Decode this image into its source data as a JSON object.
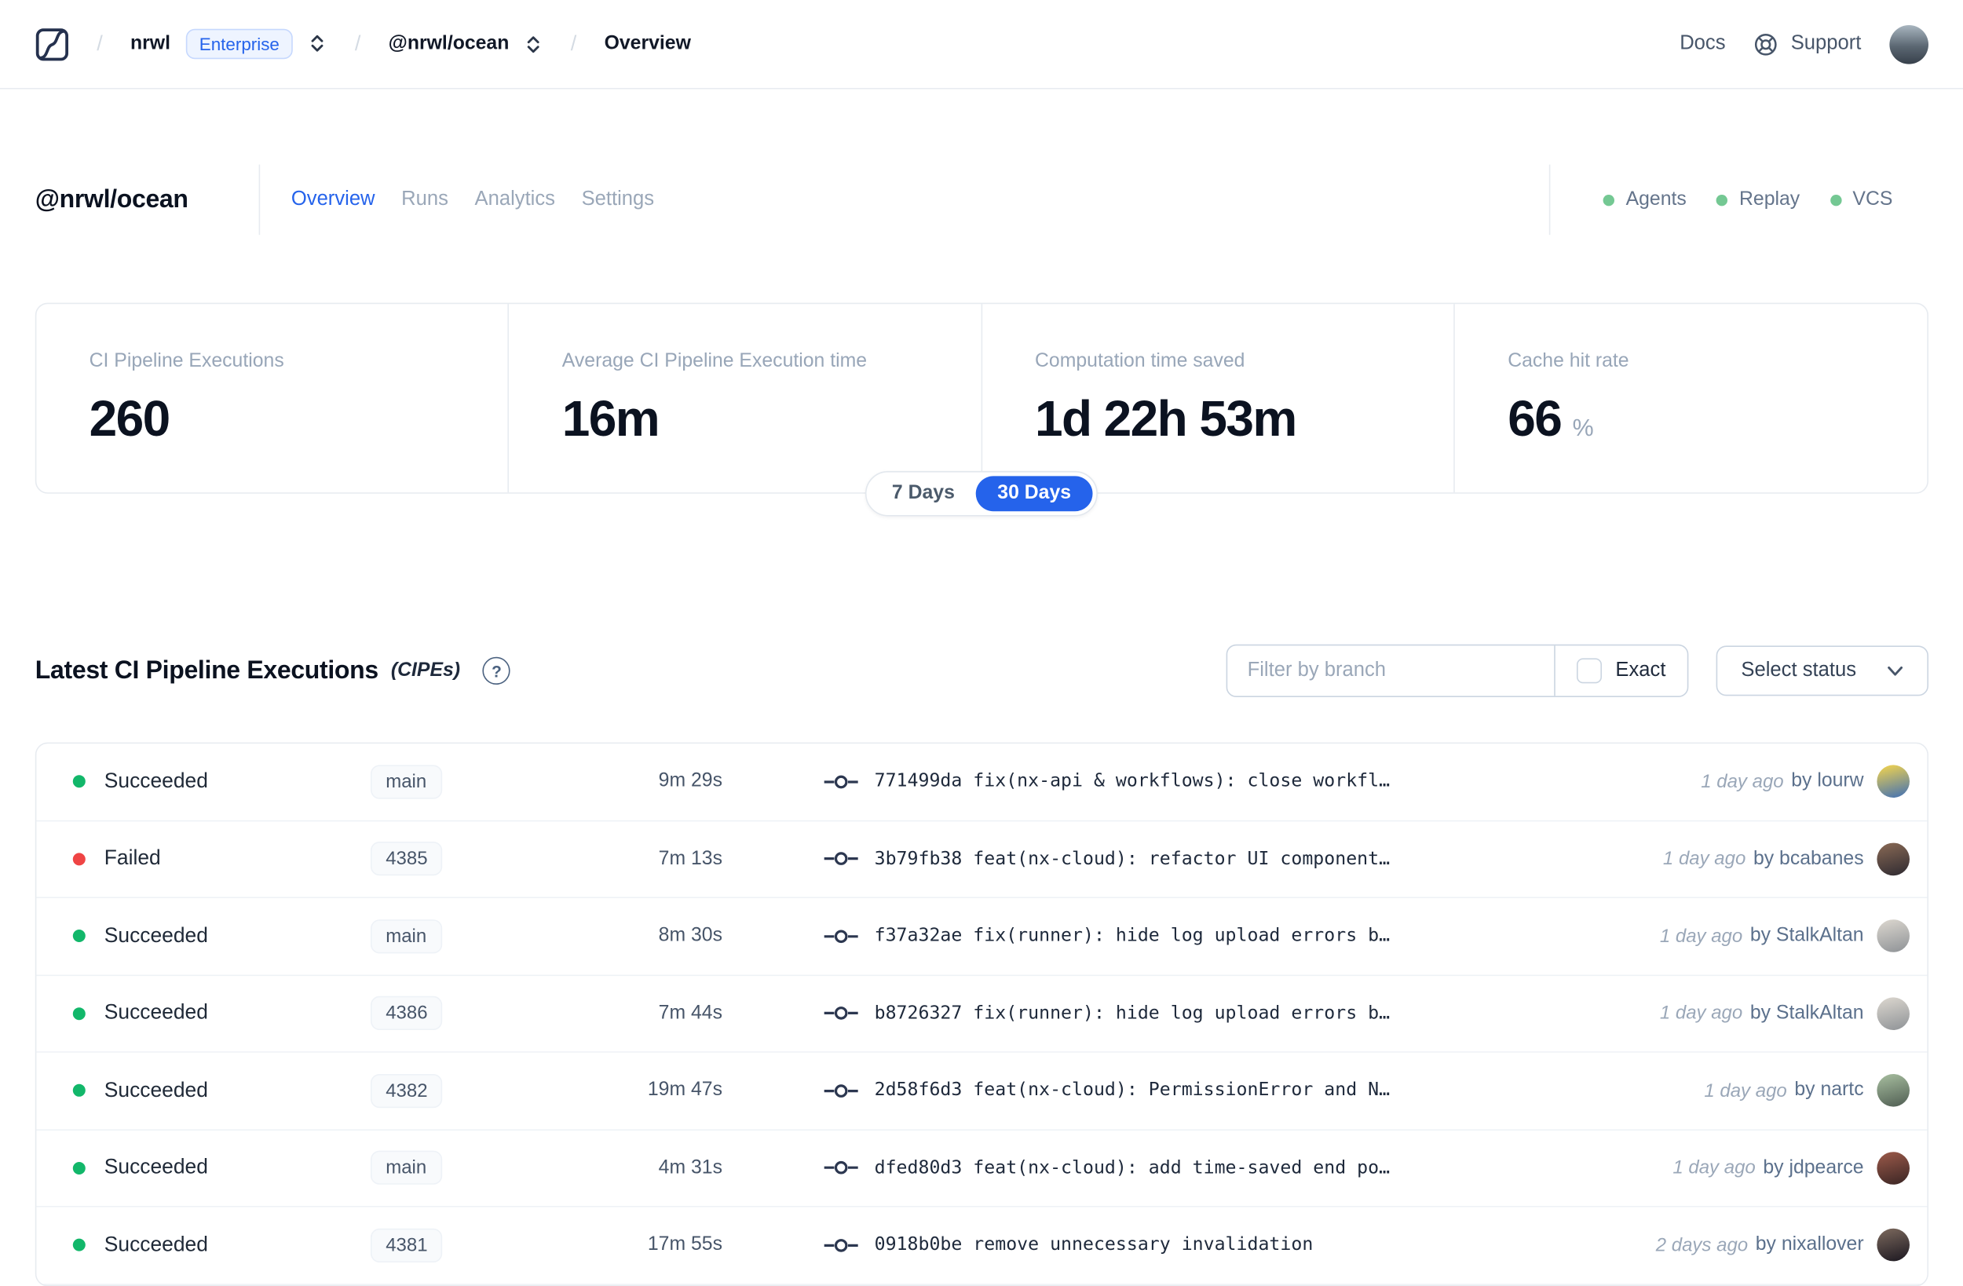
{
  "nav": {
    "logo": "nx-cloud-logo",
    "breadcrumb": {
      "separator": "/",
      "org": "nrwl",
      "plan_badge": "Enterprise",
      "workspace": "@nrwl/ocean",
      "page": "Overview"
    },
    "docs_label": "Docs",
    "support_label": "Support"
  },
  "header": {
    "title": "@nrwl/ocean",
    "tabs": [
      {
        "label": "Overview",
        "active": true
      },
      {
        "label": "Runs",
        "active": false
      },
      {
        "label": "Analytics",
        "active": false
      },
      {
        "label": "Settings",
        "active": false
      }
    ],
    "indicators": [
      {
        "label": "Agents",
        "status": "on"
      },
      {
        "label": "Replay",
        "status": "on"
      },
      {
        "label": "VCS",
        "status": "on"
      }
    ]
  },
  "stats": {
    "period_toggle": {
      "options": [
        "7 Days",
        "30 Days"
      ],
      "active": "30 Days"
    },
    "cards": [
      {
        "label": "CI Pipeline Executions",
        "value": "260"
      },
      {
        "label": "Average CI Pipeline Execution time",
        "value": "16m"
      },
      {
        "label": "Computation time saved",
        "value": "1d 22h 53m"
      },
      {
        "label": "Cache hit rate",
        "value": "66",
        "suffix": "%"
      }
    ]
  },
  "cipes": {
    "heading": "Latest CI Pipeline Executions",
    "heading_suffix": "(CIPEs)",
    "help_glyph": "?",
    "filter_placeholder": "Filter by branch",
    "exact_label": "Exact",
    "status_select_label": "Select status",
    "rows": [
      {
        "status": "Succeeded",
        "status_kind": "success",
        "branch": "main",
        "duration": "9m 29s",
        "commit": "771499da fix(nx-api & workflows): close workfl…",
        "time": "1 day ago",
        "author": "by lourw",
        "avatar": [
          "#f7d64b",
          "#3f6fb5"
        ]
      },
      {
        "status": "Failed",
        "status_kind": "failed",
        "branch": "4385",
        "duration": "7m 13s",
        "commit": "3b79fb38 feat(nx-cloud): refactor UI component…",
        "time": "1 day ago",
        "author": "by bcabanes",
        "avatar": [
          "#8a6a55",
          "#2e2a31"
        ]
      },
      {
        "status": "Succeeded",
        "status_kind": "success",
        "branch": "main",
        "duration": "8m 30s",
        "commit": "f37a32ae fix(runner): hide log upload errors b…",
        "time": "1 day ago",
        "author": "by StalkAltan",
        "avatar": [
          "#ddd8d0",
          "#8e9296"
        ]
      },
      {
        "status": "Succeeded",
        "status_kind": "success",
        "branch": "4386",
        "duration": "7m 44s",
        "commit": "b8726327 fix(runner): hide log upload errors b…",
        "time": "1 day ago",
        "author": "by StalkAltan",
        "avatar": [
          "#ddd8d0",
          "#8e9296"
        ]
      },
      {
        "status": "Succeeded",
        "status_kind": "success",
        "branch": "4382",
        "duration": "19m 47s",
        "commit": "2d58f6d3 feat(nx-cloud): PermissionError and N…",
        "time": "1 day ago",
        "author": "by nartc",
        "avatar": [
          "#a8bfa0",
          "#4f5d52"
        ]
      },
      {
        "status": "Succeeded",
        "status_kind": "success",
        "branch": "main",
        "duration": "4m 31s",
        "commit": "dfed80d3 feat(nx-cloud): add time-saved end po…",
        "time": "1 day ago",
        "author": "by jdpearce",
        "avatar": [
          "#9c5a4a",
          "#3a2524"
        ]
      },
      {
        "status": "Succeeded",
        "status_kind": "success",
        "branch": "4381",
        "duration": "17m 55s",
        "commit": "0918b0be remove unnecessary invalidation",
        "time": "2 days ago",
        "author": "by nixallover",
        "avatar": [
          "#7d6a5e",
          "#1b1720"
        ]
      }
    ]
  },
  "colors": {
    "accent_blue": "#2563eb",
    "success_green": "#12b76a",
    "failed_red": "#ef4444",
    "indicator_green": "#74c893"
  }
}
